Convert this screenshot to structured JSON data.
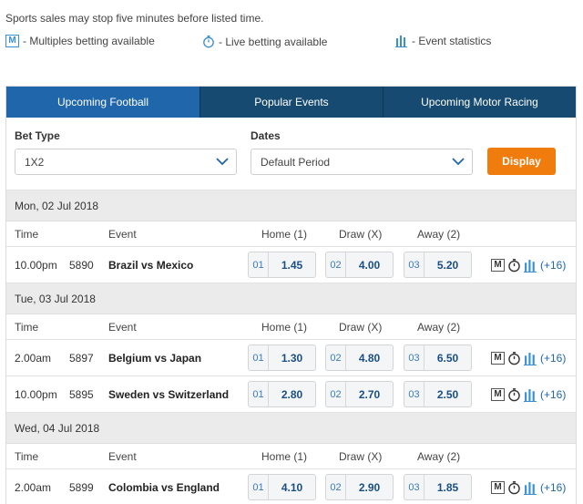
{
  "notice": "Sports sales may stop five minutes before listed time.",
  "legend": {
    "multiples_icon": "M",
    "multiples": "- Multiples betting available",
    "live": "- Live betting available",
    "stats": "- Event statistics"
  },
  "tabs": [
    "Upcoming Football",
    "Popular Events",
    "Upcoming Motor Racing"
  ],
  "filters": {
    "bet_type_label": "Bet Type",
    "bet_type_value": "1X2",
    "dates_label": "Dates",
    "dates_value": "Default Period",
    "display_label": "Display"
  },
  "columns": {
    "time": "Time",
    "event": "Event",
    "home": "Home (1)",
    "draw": "Draw (X)",
    "away": "Away (2)"
  },
  "days": [
    {
      "date": "Mon, 02 Jul 2018",
      "events": [
        {
          "time": "10.00pm",
          "num": "5890",
          "name": "Brazil vs Mexico",
          "h_code": "01",
          "home": "1.45",
          "d_code": "02",
          "draw": "4.00",
          "a_code": "03",
          "away": "5.20",
          "m": "M",
          "more": "(+16)"
        }
      ]
    },
    {
      "date": "Tue, 03 Jul 2018",
      "events": [
        {
          "time": "2.00am",
          "num": "5897",
          "name": "Belgium vs Japan",
          "h_code": "01",
          "home": "1.30",
          "d_code": "02",
          "draw": "4.80",
          "a_code": "03",
          "away": "6.50",
          "m": "M",
          "more": "(+16)"
        },
        {
          "time": "10.00pm",
          "num": "5895",
          "name": "Sweden vs Switzerland",
          "h_code": "01",
          "home": "2.80",
          "d_code": "02",
          "draw": "2.70",
          "a_code": "03",
          "away": "2.50",
          "m": "M",
          "more": "(+16)"
        }
      ]
    },
    {
      "date": "Wed, 04 Jul 2018",
      "events": [
        {
          "time": "2.00am",
          "num": "5899",
          "name": "Colombia vs England",
          "h_code": "01",
          "home": "4.10",
          "d_code": "02",
          "draw": "2.90",
          "a_code": "03",
          "away": "1.85",
          "m": "M",
          "more": "(+16)"
        }
      ]
    }
  ],
  "colors": {
    "tab_active": "#1f66aa",
    "tab_inactive": "#164a70",
    "display_button": "#f07c0e",
    "odds_text": "#1a4f86"
  }
}
